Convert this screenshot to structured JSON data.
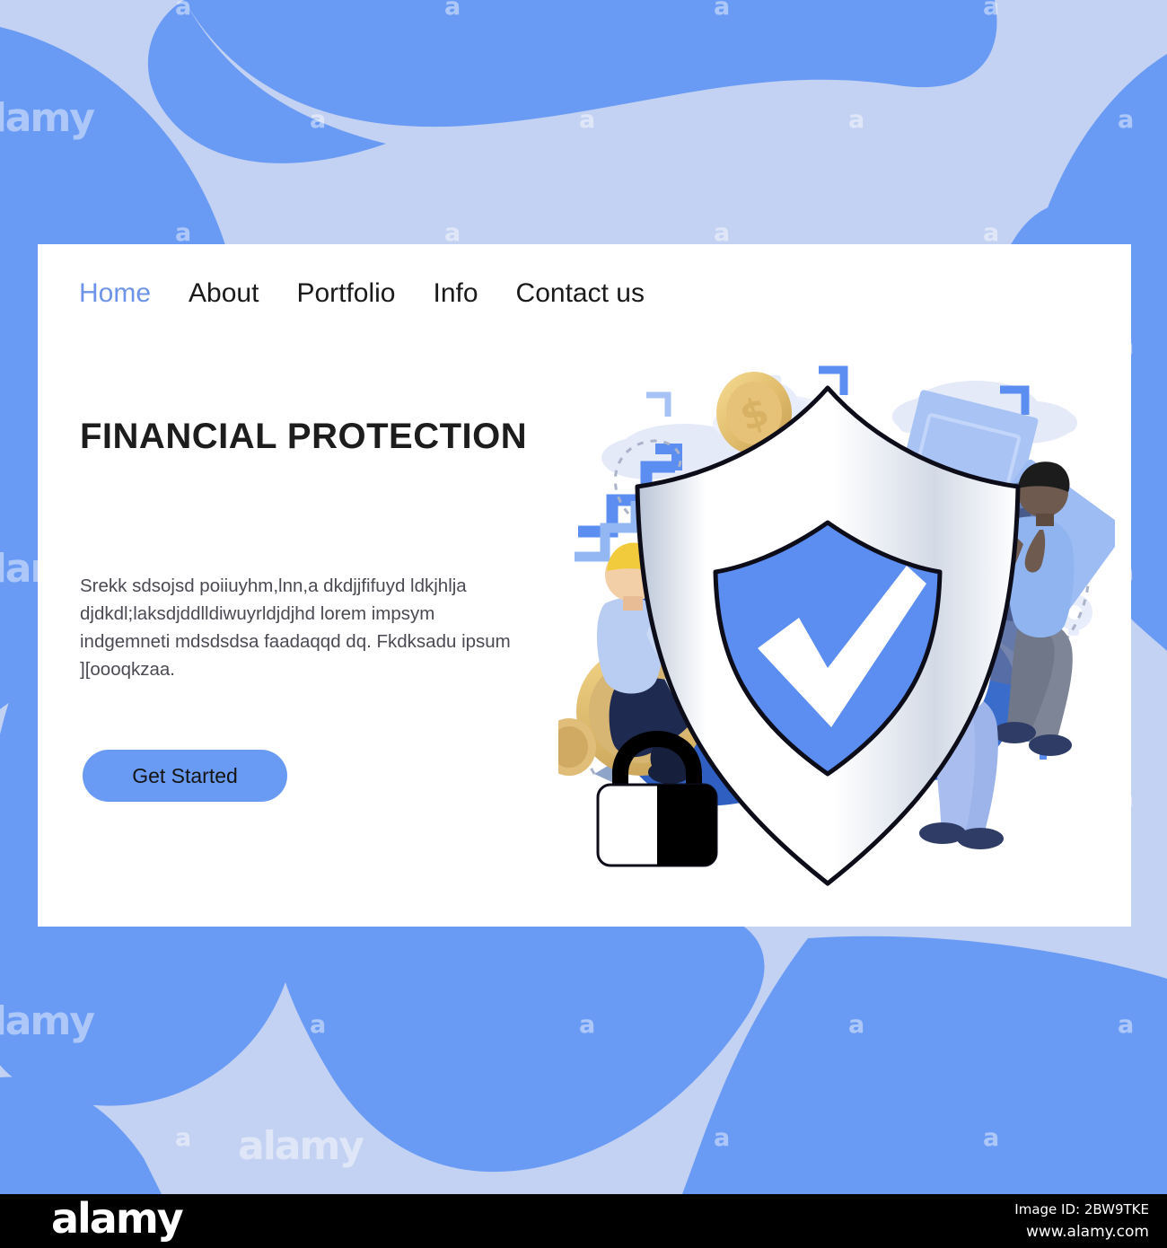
{
  "background": {
    "base_color": "#c3d2f2",
    "blob_color": "#6a9bf4",
    "watermark_letter": "a",
    "watermark_word": "alamy"
  },
  "card": {
    "background": "#ffffff"
  },
  "nav": {
    "items": [
      {
        "label": "Home",
        "active": true
      },
      {
        "label": "About",
        "active": false
      },
      {
        "label": "Portfolio",
        "active": false
      },
      {
        "label": "Info",
        "active": false
      },
      {
        "label": "Contact us",
        "active": false
      }
    ],
    "active_color": "#6d94e8",
    "color": "#1a1a1a"
  },
  "hero": {
    "headline": "FINANCIAL PROTECTION",
    "body": "Srekk  sdsojsd poiiuyhm,lnn,a dkdjjfifuyd ldkjhlja djdkdl;laksdjddlldiwuyrldjdjhd lorem impsym indgemneti  mdsdsdsa  faadaqqd  dq. Fkdksadu ipsum ][oooqkzaa.",
    "cta_label": "Get Started",
    "cta_color": "#6a9bf4"
  },
  "illustration": {
    "name": "financial-protection-illustration",
    "shield": {
      "outer_color": "#ffffff",
      "inner_color": "#5b8ef0",
      "check_color": "#ffffff",
      "outline_color": "#0d0d1a"
    },
    "padlock_color": "#000000",
    "coin_colors": {
      "light": "#f5d98a",
      "mid": "#e0b964",
      "dark": "#c39f55"
    },
    "banknote_color": "#a9c3f5",
    "cloud_color": "#e2e9f9",
    "gear_color": "#e6ecfa",
    "people": [
      {
        "name": "man-on-coin-with-laptop",
        "hair": "#f2cb3d",
        "shirt": "#b9cdf2",
        "pants": "#1e2a4f"
      },
      {
        "name": "woman-with-purple-hair",
        "hair": "#c6a6dd",
        "top": "#ffffff",
        "pants": "#9db4ea"
      },
      {
        "name": "man-with-phone",
        "hair": "#1c1c1c",
        "shirt": "#8fb4f0",
        "pants": "#7d8596"
      }
    ]
  },
  "footer": {
    "logo": "alamy",
    "image_id": "Image ID: 2BW9TKE",
    "url": "www.alamy.com",
    "background": "#000000"
  }
}
